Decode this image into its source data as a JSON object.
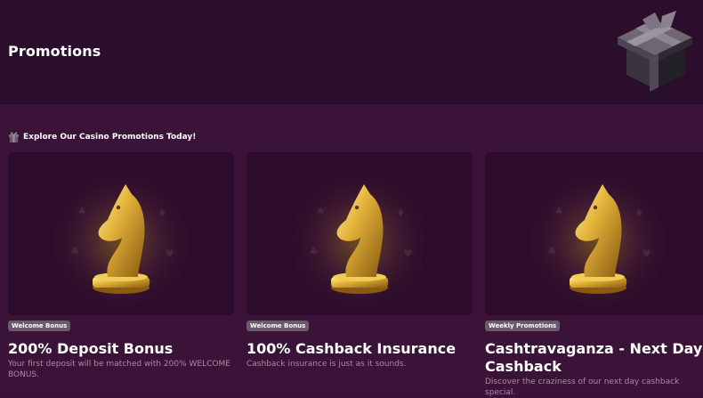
{
  "header": {
    "title": "Promotions",
    "illustration": "gift-box-icon"
  },
  "section": {
    "title": "Explore Our Casino Promotions Today!",
    "icon": "gift-icon"
  },
  "cards": [
    {
      "badge": "Welcome Bonus",
      "title": "200% Deposit Bonus",
      "description": "Your first deposit will be matched with 200% WELCOME BONUS.",
      "image": "golden-chess-knight"
    },
    {
      "badge": "Welcome Bonus",
      "title": "100% Cashback Insurance",
      "description": "Cashback insurance is just as it sounds.",
      "image": "golden-chess-knight"
    },
    {
      "badge": "Weekly Promotions",
      "title": "Cashtravaganza - Next Day Cashback",
      "description": "Discover the craziness of our next day cashback special.",
      "image": "golden-chess-knight"
    }
  ],
  "colors": {
    "header_bg": "#2b0e2b",
    "page_bg": "#3b1339",
    "card_image_bg": "#2c0b2b",
    "badge_bg": "#6b5a6c",
    "gold": "#d9a82e",
    "muted_text": "#a98aa6"
  }
}
